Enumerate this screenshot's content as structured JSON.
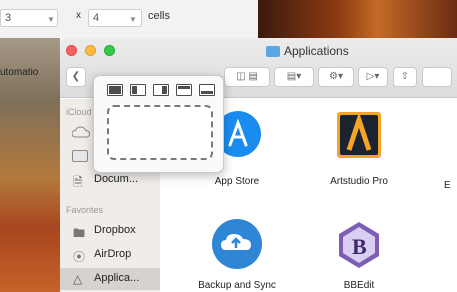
{
  "background_app": {
    "field1_value": "3",
    "times": "x",
    "field2_value": "4",
    "cells_label": "cells"
  },
  "desktop": {
    "side_text": "utomatio"
  },
  "window": {
    "title": "Applications",
    "toolbar": {
      "back_icon": "chevron-left-icon",
      "view_icons": [
        "column-view-icon",
        "cover-flow-icon"
      ],
      "arrange_icon": "arrange-icon",
      "action_icon": "gear-icon",
      "tags_icon": "tag-icon",
      "share_icon": "share-icon"
    }
  },
  "sidebar": {
    "sections": [
      {
        "header": "iCloud"
      },
      {
        "header": "Favorites"
      }
    ],
    "items": [
      {
        "label": "",
        "icon": "cloud-icon"
      },
      {
        "label": "",
        "icon": "desktop-icon"
      },
      {
        "label": "Docum...",
        "icon": "document-icon"
      },
      {
        "label": "Dropbox",
        "icon": "folder-icon"
      },
      {
        "label": "AirDrop",
        "icon": "airdrop-icon"
      },
      {
        "label": "Applica...",
        "icon": "applications-icon",
        "selected": true
      }
    ]
  },
  "apps": [
    {
      "name": "App Store",
      "icon": "app-store-icon"
    },
    {
      "name": "Artstudio Pro",
      "icon": "artstudio-icon"
    },
    {
      "name": "Backup and Sync",
      "icon": "backup-sync-icon"
    },
    {
      "name": "BBEdit",
      "icon": "bbedit-icon"
    }
  ],
  "edge_label": "E",
  "popover": {
    "layouts": [
      "layout-1-icon",
      "layout-2-icon",
      "layout-3-icon",
      "layout-4-icon",
      "layout-5-icon"
    ],
    "drop_area": ""
  }
}
